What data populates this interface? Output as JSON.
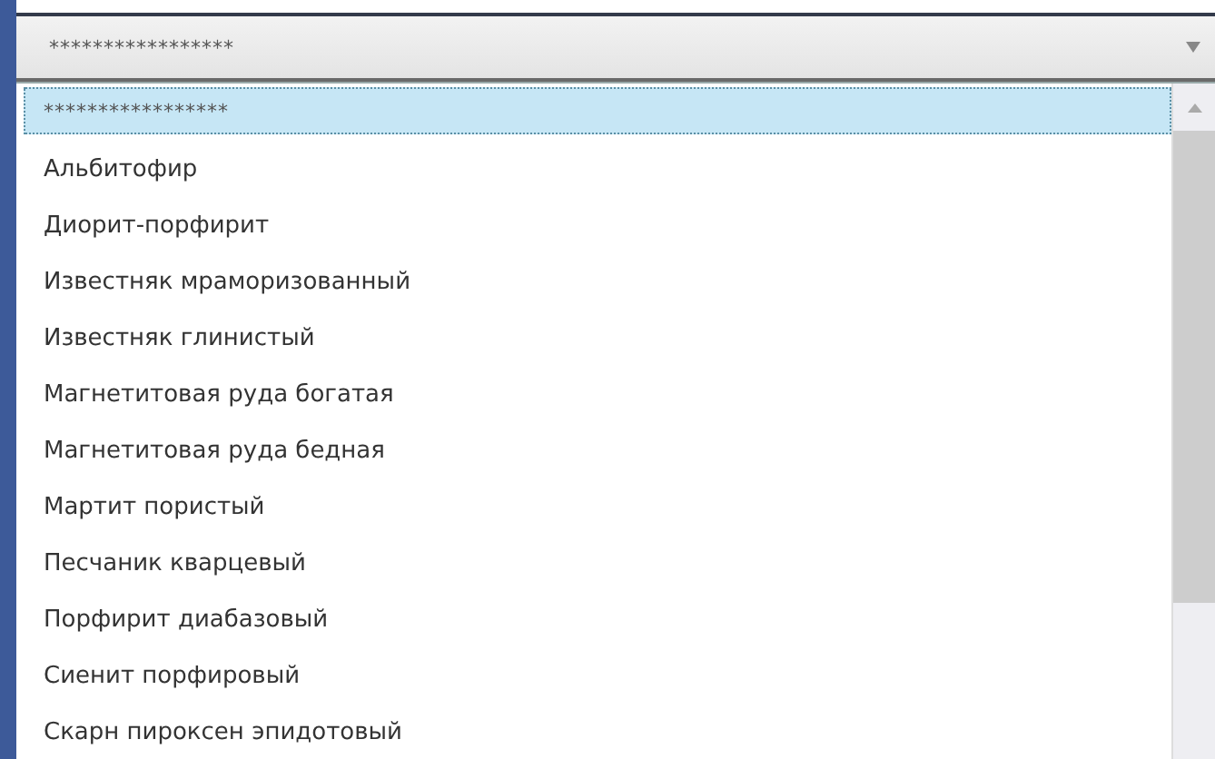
{
  "combo": {
    "value": "*****************",
    "expanded": true
  },
  "list": {
    "items": [
      {
        "label": "*****************",
        "selected": true
      },
      {
        "label": "Альбитофир",
        "selected": false
      },
      {
        "label": "Диорит-порфирит",
        "selected": false
      },
      {
        "label": "Известняк мраморизованный",
        "selected": false
      },
      {
        "label": "Известняк глинистый",
        "selected": false
      },
      {
        "label": "Магнетитовая руда богатая",
        "selected": false
      },
      {
        "label": "Магнетитовая руда бедная",
        "selected": false
      },
      {
        "label": "Мартит пористый",
        "selected": false
      },
      {
        "label": "Песчаник кварцевый",
        "selected": false
      },
      {
        "label": "Порфирит диабазовый",
        "selected": false
      },
      {
        "label": "Сиенит порфировый",
        "selected": false
      },
      {
        "label": "Скарн пироксен эпидотовый",
        "selected": false
      }
    ]
  }
}
